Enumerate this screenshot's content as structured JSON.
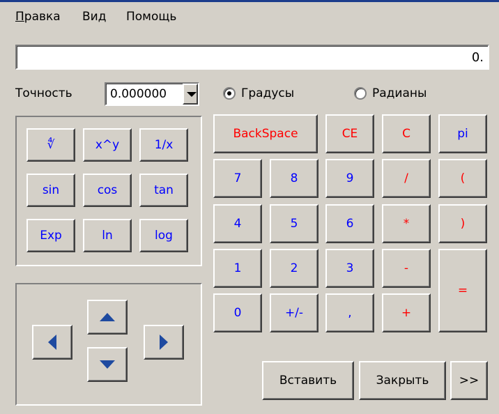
{
  "menu": {
    "edit_rest": "равка",
    "edit_first": "П",
    "view": "Вид",
    "help": "Помощь"
  },
  "display": {
    "value": "0."
  },
  "precision": {
    "label": "Точность",
    "value": "0.000000"
  },
  "angle_mode": {
    "degrees": "Градусы",
    "radians": "Радианы",
    "selected": "degrees"
  },
  "sci": {
    "root": "∜",
    "power": "x^y",
    "reciprocal": "1/x",
    "sin": "sin",
    "cos": "cos",
    "tan": "tan",
    "exp": "Exp",
    "ln": "ln",
    "log": "log"
  },
  "keys": {
    "backspace": "BackSpace",
    "ce": "CE",
    "c": "C",
    "pi": "pi",
    "d7": "7",
    "d8": "8",
    "d9": "9",
    "divide": "/",
    "lparen": "(",
    "d4": "4",
    "d5": "5",
    "d6": "6",
    "multiply": "*",
    "rparen": ")",
    "d1": "1",
    "d2": "2",
    "d3": "3",
    "minus": "-",
    "equals": "=",
    "d0": "0",
    "plusminus": "+/-",
    "comma": ",",
    "plus": "+"
  },
  "footer": {
    "paste": "Вставить",
    "close": "Закрыть",
    "more": ">>"
  },
  "colors": {
    "face": "#d4d0c8",
    "digit": "#0000ff",
    "op": "#ff0000",
    "arrow": "#1e4aa0"
  }
}
